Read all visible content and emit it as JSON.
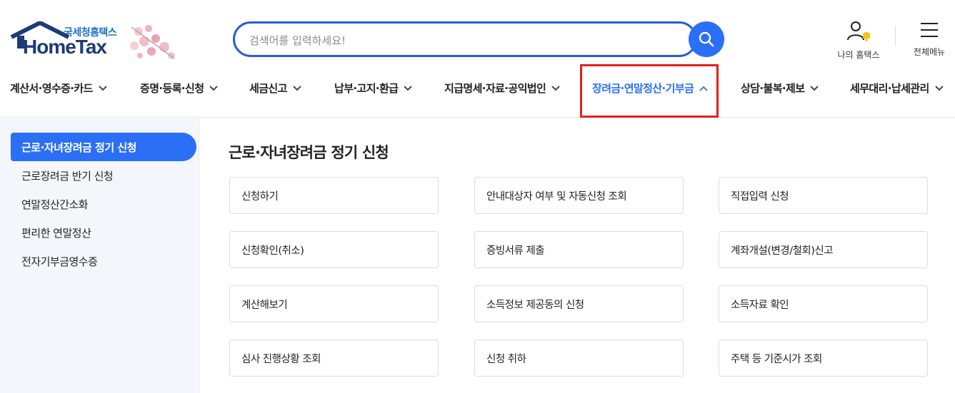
{
  "logo": {
    "korean": "국세청홈택스",
    "english": "HomeTax"
  },
  "search": {
    "placeholder": "검색어를 입력하세요!"
  },
  "header": {
    "my_hometax": "나의 홈택스",
    "all_menu": "전체메뉴"
  },
  "nav": {
    "items": [
      {
        "label": "계산서·영수증·카드"
      },
      {
        "label": "증명·등록·신청"
      },
      {
        "label": "세금신고"
      },
      {
        "label": "납부·고지·환급"
      },
      {
        "label": "지급명세·자료·공익법인"
      },
      {
        "label": "장려금·연말정산·기부금",
        "active": true
      },
      {
        "label": "상담·불복·제보"
      },
      {
        "label": "세무대리·납세관리"
      }
    ]
  },
  "sidebar": {
    "items": [
      {
        "label": "근로·자녀장려금 정기 신청",
        "active": true
      },
      {
        "label": "근로장려금 반기 신청"
      },
      {
        "label": "연말정산간소화"
      },
      {
        "label": "편리한 연말정산"
      },
      {
        "label": "전자기부금영수증"
      }
    ]
  },
  "main": {
    "title": "근로·자녀장려금 정기 신청",
    "cards": [
      "신청하기",
      "안내대상자 여부 및 자동신청 조회",
      "직접입력 신청",
      "신청확인(취소)",
      "증빙서류 제출",
      "계좌개설(변경/철회)신고",
      "계산해보기",
      "소득정보 제공동의 신청",
      "소득자료 확인",
      "심사 진행상황 조회",
      "신청 취하",
      "주택 등 기준시가 조회"
    ]
  },
  "colors": {
    "accent": "#2a6ff5",
    "highlight": "#e02020",
    "logo_navy": "#1e3a78"
  }
}
